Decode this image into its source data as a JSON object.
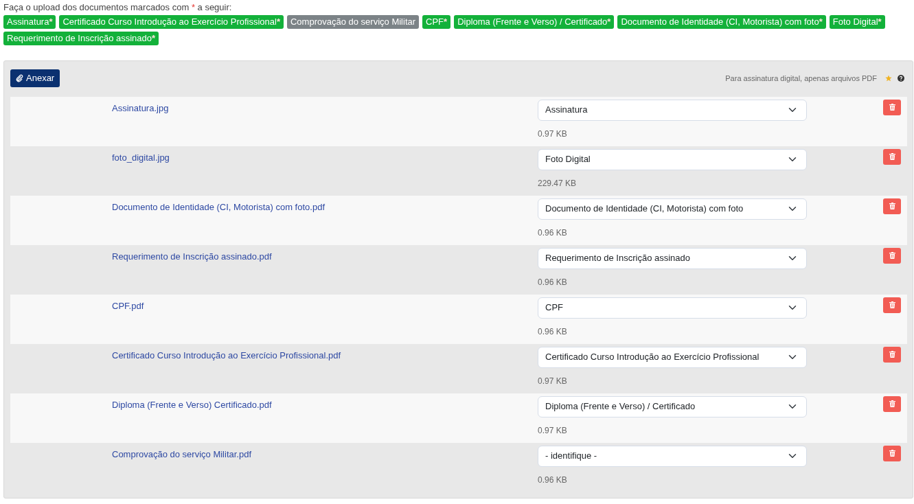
{
  "intro": {
    "before": "Faça o upload dos documentos marcados com",
    "mark": "*",
    "after": "a seguir:"
  },
  "tags": [
    {
      "label": "Assinatura",
      "mark": "*",
      "done": true
    },
    {
      "label": "Certificado Curso Introdução ao Exercício Profissional",
      "mark": "*",
      "done": true
    },
    {
      "label": "Comprovação do serviço Militar",
      "done": false
    },
    {
      "label": "CPF",
      "mark": "*",
      "done": true
    },
    {
      "label": "Diploma (Frente e Verso) / Certificado",
      "mark": "*",
      "done": true
    },
    {
      "label": "Documento de Identidade (CI, Motorista) com foto",
      "mark": "*",
      "done": true
    },
    {
      "label": "Foto Digital",
      "mark": "*",
      "done": true
    },
    {
      "label": "Requerimento de Inscrição assinado",
      "mark": "*",
      "done": true
    }
  ],
  "attach_button": "Anexar",
  "hint": "Para assinatura digital, apenas arquivos PDF",
  "files": [
    {
      "name": "Assinatura.jpg",
      "type": "Assinatura",
      "size": "0.97 KB"
    },
    {
      "name": "foto_digital.jpg",
      "type": "Foto Digital",
      "size": "229.47 KB"
    },
    {
      "name": "Documento de Identidade (CI, Motorista) com foto.pdf",
      "type": "Documento de Identidade (CI, Motorista) com foto",
      "size": "0.96 KB"
    },
    {
      "name": "Requerimento de Inscrição assinado.pdf",
      "type": "Requerimento de Inscrição assinado",
      "size": "0.96 KB"
    },
    {
      "name": "CPF.pdf",
      "type": "CPF",
      "size": "0.96 KB"
    },
    {
      "name": "Certificado Curso Introdução ao Exercício Profissional.pdf",
      "type": "Certificado Curso Introdução ao Exercício Profissional",
      "size": "0.97 KB"
    },
    {
      "name": "Diploma (Frente e Verso) Certificado.pdf",
      "type": "Diploma (Frente e Verso) / Certificado",
      "size": "0.97 KB"
    },
    {
      "name": "Comprovação do serviço Militar.pdf",
      "type": "- identifique -",
      "size": "0.96 KB"
    }
  ]
}
